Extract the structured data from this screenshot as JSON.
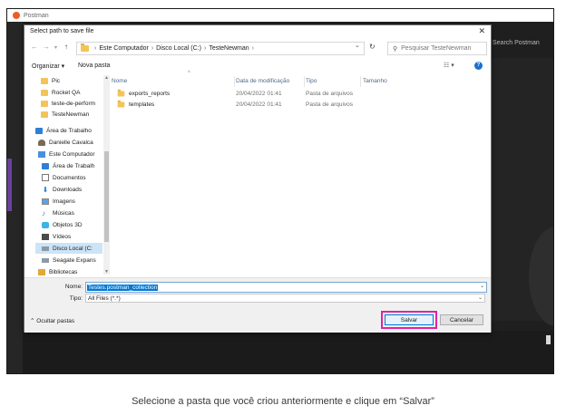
{
  "app": {
    "title": "Postman",
    "search_hint": "Search Postman"
  },
  "dialog": {
    "title": "Select path to save file",
    "close": "✕",
    "breadcrumb": [
      "Este Computador",
      "Disco Local (C:)",
      "TesteNewman"
    ],
    "search_placeholder": "Pesquisar TesteNewman",
    "toolbar": {
      "organize": "Organizar ▾",
      "new_folder": "Nova pasta"
    },
    "nav": [
      {
        "label": "Pic",
        "icon": "folder-icon"
      },
      {
        "label": "Rocket QA",
        "icon": "folder-icon"
      },
      {
        "label": "teste-de-perform",
        "icon": "folder-icon"
      },
      {
        "label": "TesteNewman",
        "icon": "folder-icon"
      },
      {
        "label": "Área de Trabalho",
        "icon": "desktop-icon"
      },
      {
        "label": "Danielle Cavalca",
        "icon": "user-icon"
      },
      {
        "label": "Este Computador",
        "icon": "computer-icon"
      },
      {
        "label": "Área de Trabalh",
        "icon": "desktop-icon"
      },
      {
        "label": "Documentos",
        "icon": "document-icon"
      },
      {
        "label": "Downloads",
        "icon": "download-icon"
      },
      {
        "label": "Imagens",
        "icon": "image-icon"
      },
      {
        "label": "Músicas",
        "icon": "music-icon"
      },
      {
        "label": "Objetos 3D",
        "icon": "cube-icon"
      },
      {
        "label": "Vídeos",
        "icon": "video-icon"
      },
      {
        "label": "Disco Local (C:",
        "icon": "disk-icon"
      },
      {
        "label": "Seagate Expans",
        "icon": "disk-icon"
      },
      {
        "label": "Bibliotecas",
        "icon": "library-icon"
      }
    ],
    "columns": {
      "name": "Nome",
      "date": "Data de modificação",
      "type": "Tipo",
      "size": "Tamanho"
    },
    "files": [
      {
        "name": "exports_reports",
        "date": "20/04/2022 01:41",
        "type": "Pasta de arquivos"
      },
      {
        "name": "templates",
        "date": "20/04/2022 01:41",
        "type": "Pasta de arquivos"
      }
    ],
    "filename_label": "Nome:",
    "filename_value": "Testes.postman_collection",
    "type_label": "Tipo:",
    "type_value": "All Files (*.*)",
    "hide_folders": "Ocultar pastas",
    "save": "Salvar",
    "cancel": "Cancelar"
  },
  "caption": "Selecione a pasta que você criou anteriormente e clique em “Salvar”",
  "colors": {
    "highlight": "#e0249f",
    "selection": "#0078d7"
  }
}
